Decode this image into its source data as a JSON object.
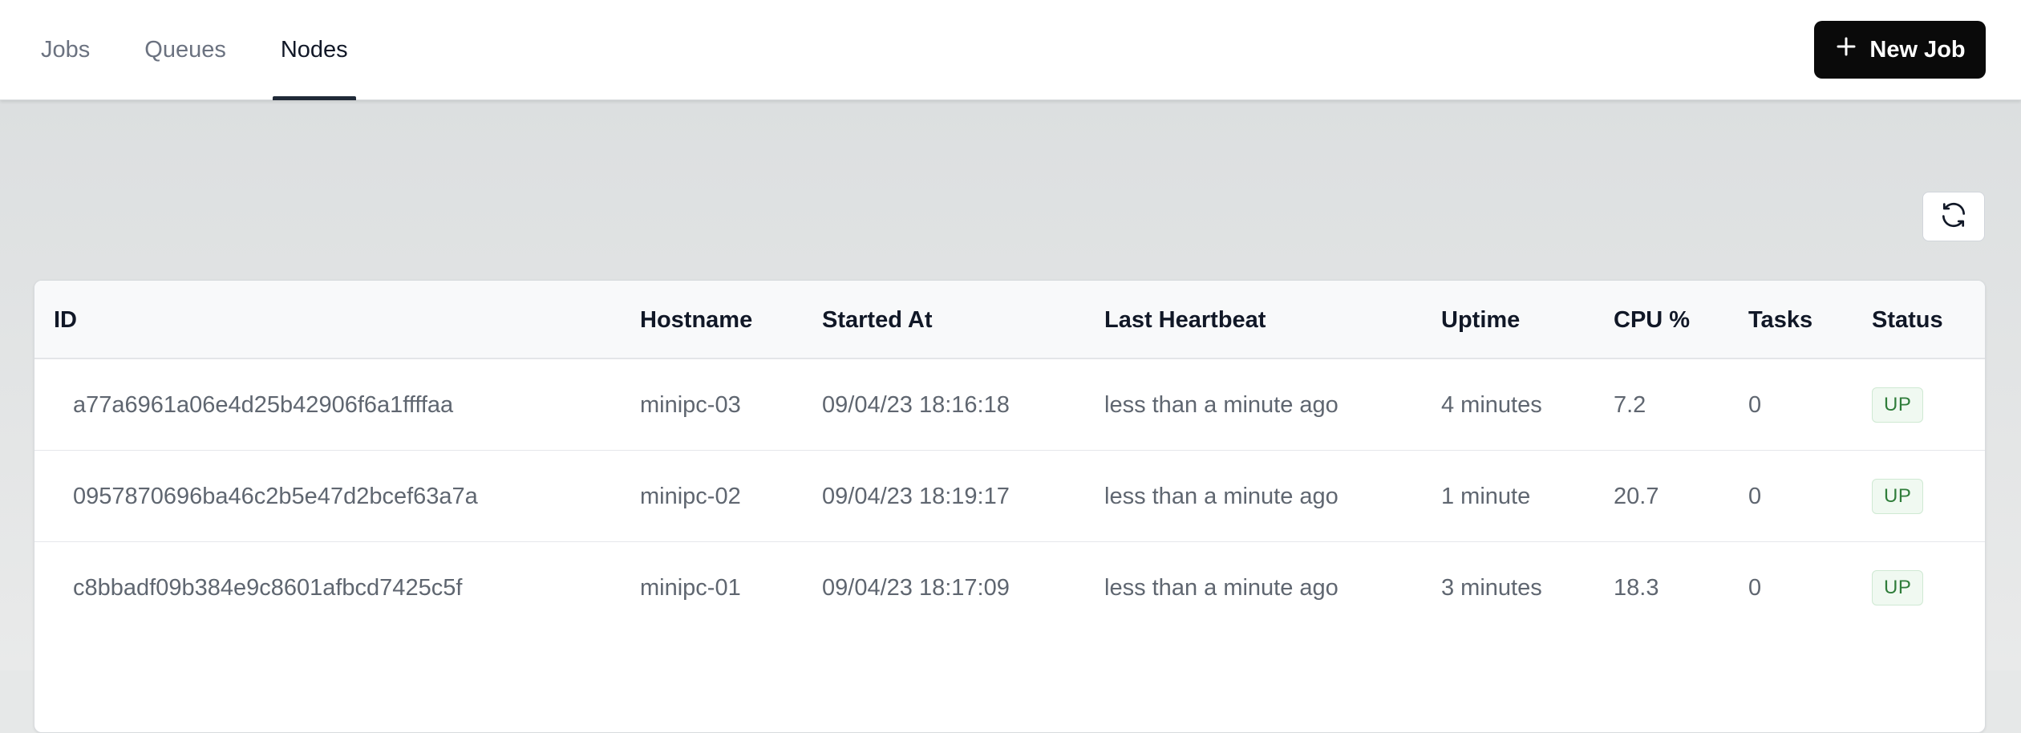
{
  "nav": {
    "tabs": [
      {
        "label": "Jobs"
      },
      {
        "label": "Queues"
      },
      {
        "label": "Nodes"
      }
    ],
    "active_tab": "Nodes"
  },
  "actions": {
    "new_job_label": "New Job",
    "new_job_icon": "plus-icon",
    "refresh_icon": "refresh-icon"
  },
  "table": {
    "columns": [
      "ID",
      "Hostname",
      "Started At",
      "Last Heartbeat",
      "Uptime",
      "CPU %",
      "Tasks",
      "Status"
    ],
    "rows": [
      {
        "id": "a77a6961a06e4d25b42906f6a1ffffaa",
        "hostname": "minipc-03",
        "started_at": "09/04/23 18:16:18",
        "last_heartbeat": "less than a minute ago",
        "uptime": "4 minutes",
        "cpu": "7.2",
        "tasks": "0",
        "status": "UP"
      },
      {
        "id": "0957870696ba46c2b5e47d2bcef63a7a",
        "hostname": "minipc-02",
        "started_at": "09/04/23 18:19:17",
        "last_heartbeat": "less than a minute ago",
        "uptime": "1 minute",
        "cpu": "20.7",
        "tasks": "0",
        "status": "UP"
      },
      {
        "id": "c8bbadf09b384e9c8601afbcd7425c5f",
        "hostname": "minipc-01",
        "started_at": "09/04/23 18:17:09",
        "last_heartbeat": "less than a minute ago",
        "uptime": "3 minutes",
        "cpu": "18.3",
        "tasks": "0",
        "status": "UP"
      }
    ]
  },
  "colors": {
    "primary_button": "#0a0a0a",
    "status_up_text": "#2f7d3a",
    "status_up_bg": "#f0f9f1"
  }
}
